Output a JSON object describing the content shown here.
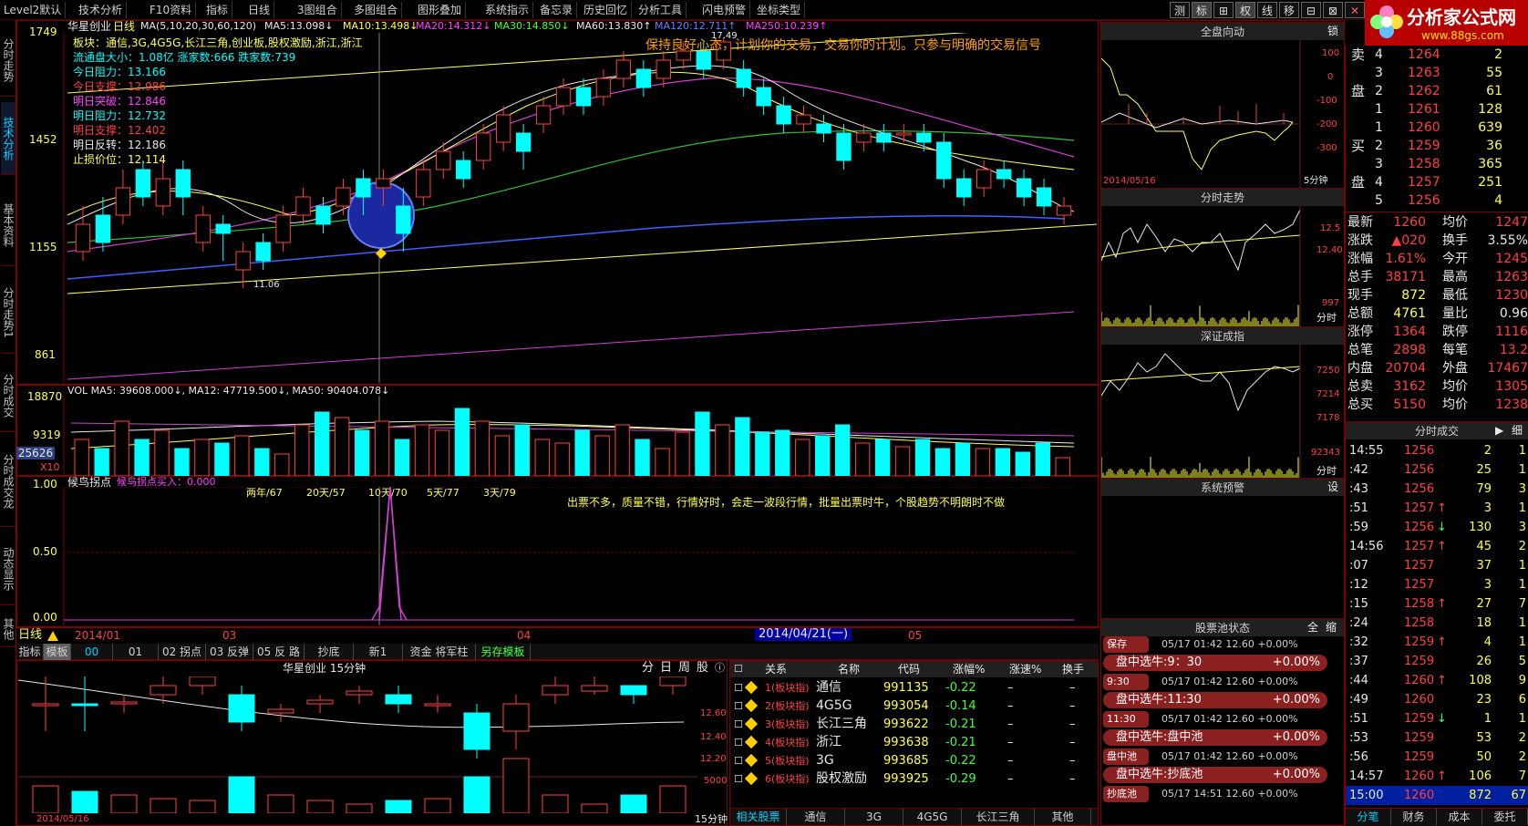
{
  "menubar": {
    "items": [
      "Level2默认",
      "技术分析",
      "F10资料",
      "指标",
      "日线",
      "3图组合",
      "多图组合",
      "图形叠加",
      "系统指示",
      "备忘录",
      "历史回忆",
      "分析工具",
      "闪电预警",
      "坐标类型"
    ],
    "right_buttons": [
      "测",
      "标",
      "⊞",
      "权",
      "线",
      "移",
      "⊟",
      "⊠",
      "✕"
    ]
  },
  "logo": {
    "title": "分析家公式网",
    "url": "www.88gs.com"
  },
  "left_nav": [
    "分时走势",
    "技术分析",
    "基本资料",
    "分时走势1",
    "分时成交",
    "分时成交龙",
    "动态显示",
    "其他"
  ],
  "chart": {
    "stock_title": "华星创业",
    "period": "日线",
    "ma_header": "MA(5,10,20,30,60,120)",
    "ma_values": [
      {
        "label": "MA5:",
        "value": "13.098↓"
      },
      {
        "label": "MA10:",
        "value": "13.498↓"
      },
      {
        "label": "MA20:",
        "value": "14.312↓"
      },
      {
        "label": "MA30:",
        "value": "14.850↓"
      },
      {
        "label": "MA60:",
        "value": "13.830↑"
      },
      {
        "label": "MA120:",
        "value": "12.711↑"
      },
      {
        "label": "MA250:",
        "value": "10.239↑"
      }
    ],
    "y_ticks": [
      "1749",
      "1452",
      "1155",
      "861"
    ],
    "info_lines": [
      "板块：通信,3G,4G5G,长江三角,创业板,股权激励,浙江,浙江",
      "流通盘大小：1.08亿   涨家数:666   跌家数:739",
      "今日阻力：13.166",
      "今日支撑：12.986",
      "明日突破：12.846",
      "明日阻力：12.732",
      "明日支撑：12.402",
      "明日反转：12.186",
      "止损价位：12.114"
    ],
    "slogan": "保持良好心态，计划你的交易，交易你的计划。只参与明确的交易信号",
    "high_label": "17.49",
    "low_label": "11.06"
  },
  "volume": {
    "header": "VOL MA5: 39608.000↓, MA12: 47719.500↓, MA50: 90404.078↓",
    "y_ticks": [
      "18870",
      "9319"
    ],
    "highlight_value": "25626",
    "x_label": "X10"
  },
  "indicator": {
    "name": "候鸟拐点",
    "line_label": "候鸟拐点买入：0.000",
    "y_ticks": [
      "1.00",
      "0.50",
      "0.00"
    ],
    "tags": [
      "两年/67",
      "20天/57",
      "10天/70",
      "5天/77",
      "3天/79"
    ],
    "comment": "出票不多，质量不错，行情好时，会走一波段行情，批量出票时牛，个股趋势不明朗时不做"
  },
  "date_axis": {
    "period": "日线",
    "labels": [
      "2014/01",
      "03",
      "04",
      "05"
    ],
    "cursor_date": "2014/04/21(一)"
  },
  "template_bar": [
    "指标",
    "模板",
    "00",
    "01",
    "02 拐点",
    "03 反弹",
    "05 反 路",
    "抄底",
    "新1",
    "资金 将军柱",
    "另存模板"
  ],
  "mini_chart": {
    "title": "华星创业 15分钟",
    "buttons": [
      "分",
      "日",
      "周",
      "股",
      "ⓘ"
    ],
    "y_ticks": [
      "12.60",
      "12.40",
      "12.20",
      "5000"
    ],
    "date": "2014/05/16",
    "period": "15分钟"
  },
  "related": {
    "columns": [
      "关系",
      "名称",
      "代码",
      "涨幅%",
      "涨速%",
      "换手"
    ],
    "rows": [
      {
        "rel": "1(板块指)",
        "name": "通信",
        "code": "991135",
        "chg": "-0.22",
        "speed": "–",
        "turn": "–"
      },
      {
        "rel": "2(板块指)",
        "name": "4G5G",
        "code": "993054",
        "chg": "-0.14",
        "speed": "–",
        "turn": "–"
      },
      {
        "rel": "3(板块指)",
        "name": "长江三角",
        "code": "993622",
        "chg": "-0.21",
        "speed": "–",
        "turn": "–"
      },
      {
        "rel": "4(板块指)",
        "name": "浙江",
        "code": "993638",
        "chg": "-0.21",
        "speed": "–",
        "turn": "–"
      },
      {
        "rel": "5(板块指)",
        "name": "3G",
        "code": "993685",
        "chg": "-0.22",
        "speed": "–",
        "turn": "–"
      },
      {
        "rel": "6(板块指)",
        "name": "股权激励",
        "code": "993925",
        "chg": "-0.29",
        "speed": "–",
        "turn": "–"
      }
    ],
    "tabs": [
      "相关股票",
      "通信",
      "3G",
      "4G5G",
      "长江三角",
      "其他"
    ]
  },
  "right_panels": {
    "quanpan": {
      "title": "全盘向动",
      "ticks": [
        "100",
        "0",
        "-100",
        "-200",
        "-300"
      ],
      "date": "2014/05/16",
      "period": "5分钟",
      "extra": "锁"
    },
    "fenshi": {
      "title": "分时走势",
      "ticks": [
        "12.5",
        "12.40",
        "997"
      ],
      "period": "分时"
    },
    "shenzheng": {
      "title": "深证成指",
      "ticks": [
        "7250",
        "7214",
        "7178",
        "92343"
      ],
      "period": "分时"
    },
    "yujing": {
      "title": "系统预警",
      "extra": "设"
    },
    "pool": {
      "title": "股票池状态",
      "buttons": [
        "全",
        "缩"
      ],
      "entries": [
        {
          "tag": "保存",
          "detail": "05/17 01:42 12.60 +0.00%",
          "bar": "盘中选牛:9：30",
          "pct": "+0.00%"
        },
        {
          "tag": "9:30",
          "detail": "05/17 01:42 12.60 +0.00%",
          "bar": "盘中选牛:11:30",
          "pct": "+0.00%"
        },
        {
          "tag": "11:30",
          "detail": "05/17 01:42 12.60 +0.00%",
          "bar": "盘中选牛:盘中池",
          "pct": "+0.00%"
        },
        {
          "tag": "盘中池",
          "detail": "05/17 01:42 12.60 +0.00%",
          "bar": "盘中选牛:抄底池",
          "pct": "+0.00%"
        },
        {
          "tag": "抄底池",
          "detail": "05/17 14:51 12.60 +0.00%",
          "bar": "",
          "pct": ""
        }
      ]
    }
  },
  "orderbook": {
    "sell": [
      {
        "label": "卖",
        "lvl": "4",
        "price": "1264",
        "vol": "2"
      },
      {
        "lvl": "3",
        "price": "1263",
        "vol": "55"
      },
      {
        "label": "盘",
        "lvl": "2",
        "price": "1262",
        "vol": "61"
      },
      {
        "lvl": "1",
        "price": "1261",
        "vol": "128"
      }
    ],
    "buy": [
      {
        "lvl": "1",
        "price": "1260",
        "vol": "639"
      },
      {
        "label": "买",
        "lvl": "2",
        "price": "1259",
        "vol": "36"
      },
      {
        "lvl": "3",
        "price": "1258",
        "vol": "365"
      },
      {
        "label": "盘",
        "lvl": "4",
        "price": "1257",
        "vol": "251"
      },
      {
        "lvl": "5",
        "price": "1256",
        "vol": "4"
      }
    ]
  },
  "stats": [
    {
      "k1": "最新",
      "v1": "1260",
      "k2": "均价",
      "v2": "1247"
    },
    {
      "k1": "涨跌",
      "v1": "▲020",
      "k2": "换手",
      "v2": "3.55%"
    },
    {
      "k1": "涨幅",
      "v1": "1.61%",
      "k2": "今开",
      "v2": "1245"
    },
    {
      "k1": "总手",
      "v1": "38171",
      "k2": "最高",
      "v2": "1263"
    },
    {
      "k1": "现手",
      "v1": "872",
      "k2": "最低",
      "v2": "1230"
    },
    {
      "k1": "总额",
      "v1": "4761",
      "k2": "量比",
      "v2": "0.96"
    },
    {
      "k1": "涨停",
      "v1": "1364",
      "k2": "跌停",
      "v2": "1116"
    },
    {
      "k1": "总笔",
      "v1": "2898",
      "k2": "每笔",
      "v2": "13.2"
    },
    {
      "k1": "内盘",
      "v1": "20704",
      "k2": "外盘",
      "v2": "17467"
    },
    {
      "k1": "总卖",
      "v1": "3162",
      "k2": "均价",
      "v2": "1305"
    },
    {
      "k1": "总买",
      "v1": "5150",
      "k2": "均价",
      "v2": "1238"
    }
  ],
  "ticks_title": "分时成交",
  "ticks_extra": "细",
  "ticks": [
    {
      "t": "14:55",
      "p": "1256",
      "a": "",
      "v": "2",
      "n": "1"
    },
    {
      "t": ":42",
      "p": "1256",
      "a": "",
      "v": "25",
      "n": "1"
    },
    {
      "t": ":43",
      "p": "1256",
      "a": "",
      "v": "79",
      "n": "3"
    },
    {
      "t": ":51",
      "p": "1257",
      "a": "↑",
      "v": "3",
      "n": "1"
    },
    {
      "t": ":59",
      "p": "1256",
      "a": "↓",
      "v": "130",
      "n": "3"
    },
    {
      "t": "14:56",
      "p": "1257",
      "a": "↑",
      "v": "45",
      "n": "2"
    },
    {
      "t": ":07",
      "p": "1257",
      "a": "",
      "v": "37",
      "n": "1"
    },
    {
      "t": ":12",
      "p": "1257",
      "a": "",
      "v": "3",
      "n": "1"
    },
    {
      "t": ":15",
      "p": "1258",
      "a": "↑",
      "v": "27",
      "n": "7"
    },
    {
      "t": ":24",
      "p": "1258",
      "a": "",
      "v": "18",
      "n": "1"
    },
    {
      "t": ":32",
      "p": "1259",
      "a": "↑",
      "v": "4",
      "n": "1"
    },
    {
      "t": ":37",
      "p": "1259",
      "a": "",
      "v": "26",
      "n": "5"
    },
    {
      "t": ":44",
      "p": "1260",
      "a": "↑",
      "v": "108",
      "n": "9"
    },
    {
      "t": ":49",
      "p": "1260",
      "a": "",
      "v": "23",
      "n": "6"
    },
    {
      "t": ":51",
      "p": "1259",
      "a": "↓",
      "v": "1",
      "n": "1"
    },
    {
      "t": ":53",
      "p": "1259",
      "a": "",
      "v": "53",
      "n": "2"
    },
    {
      "t": ":56",
      "p": "1259",
      "a": "",
      "v": "50",
      "n": "2"
    },
    {
      "t": "14:57",
      "p": "1260",
      "a": "↑",
      "v": "106",
      "n": "7"
    },
    {
      "t": "15:00",
      "p": "1260",
      "a": "",
      "v": "872",
      "n": "67"
    }
  ],
  "bottom_tabs": [
    "分笔",
    "财务",
    "成本",
    "委托"
  ]
}
